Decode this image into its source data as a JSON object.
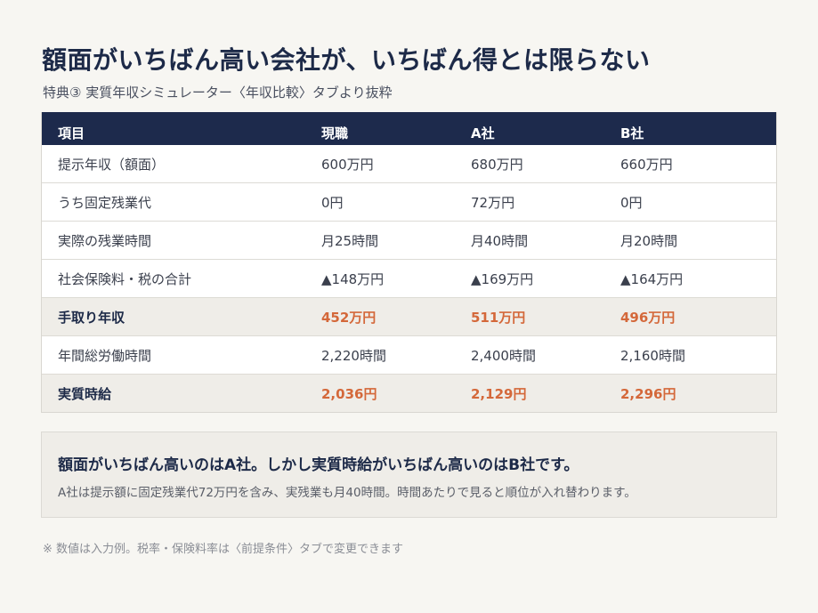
{
  "header": {
    "title": "額面がいちばん高い会社が、いちばん得とは限らない",
    "subtitle": "特典③ 実質年収シミュレーター〈年収比較〉タブより抜粋"
  },
  "table": {
    "columns": [
      "項目",
      "現職",
      "A社",
      "B社"
    ],
    "rows": [
      {
        "label": "提示年収（額面）",
        "cells": [
          "600万円",
          "680万円",
          "660万円"
        ]
      },
      {
        "label": "うち固定残業代",
        "cells": [
          "0円",
          "72万円",
          "0円"
        ]
      },
      {
        "label": "実際の残業時間",
        "cells": [
          "月25時間",
          "月40時間",
          "月20時間"
        ]
      },
      {
        "label": "社会保険料・税の合計",
        "cells": [
          "▲148万円",
          "▲169万円",
          "▲164万円"
        ]
      },
      {
        "label": "手取り年収",
        "cells": [
          "452万円",
          "511万円",
          "496万円"
        ]
      },
      {
        "label": "年間総労働時間",
        "cells": [
          "2,220時間",
          "2,400時間",
          "2,160時間"
        ]
      },
      {
        "label": "実質時給",
        "cells": [
          "2,036円",
          "2,129円",
          "2,296円"
        ]
      }
    ]
  },
  "note": {
    "headline": "額面がいちばん高いのはA社。しかし実質時給がいちばん高いのはB社です。",
    "body": "A社は提示額に固定残業代72万円を含み、実残業も月40時間。時間あたりで見ると順位が入れ替わります。"
  },
  "footnote": "※ 数値は入力例。税率・保険料率は〈前提条件〉タブで変更できます",
  "colors": {
    "navy": "#1d2a4c",
    "accent": "#d4683a",
    "background": "#f7f6f2"
  }
}
